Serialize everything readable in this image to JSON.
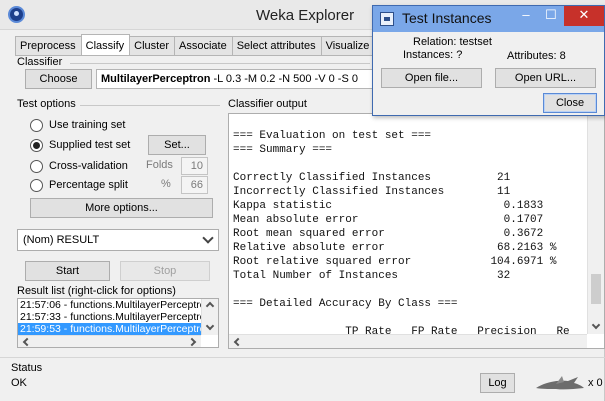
{
  "main_window": {
    "title": "Weka Explorer",
    "tabs": [
      "Preprocess",
      "Classify",
      "Cluster",
      "Associate",
      "Select attributes",
      "Visualize"
    ],
    "active_tab": "Classify"
  },
  "classifier": {
    "section_label": "Classifier",
    "choose_label": "Choose",
    "name": "MultilayerPerceptron",
    "options": " -L 0.3 -M 0.2 -N 500 -V 0 -S 0"
  },
  "test_options": {
    "label": "Test options",
    "use_training": "Use training set",
    "supplied": "Supplied test set",
    "set_button": "Set...",
    "cross_validation": "Cross-validation",
    "folds_label": "Folds",
    "folds_value": "10",
    "percentage_split": "Percentage split",
    "percent_label": "%",
    "percent_value": "66",
    "more_options": "More options..."
  },
  "class_select": {
    "value": "(Nom) RESULT"
  },
  "actions": {
    "start": "Start",
    "stop": "Stop"
  },
  "result_list": {
    "label": "Result list (right-click for options)",
    "items": [
      "21:57:06 - functions.MultilayerPerceptron",
      "21:57:33 - functions.MultilayerPerceptron",
      "21:59:53 - functions.MultilayerPerceptron"
    ]
  },
  "output": {
    "label": "Classifier output",
    "lines": [
      "=== Evaluation on test set ===",
      "=== Summary ===",
      "",
      "Correctly Classified Instances          21",
      "Incorrectly Classified Instances        11",
      "Kappa statistic                          0.1833",
      "Mean absolute error                      0.1707",
      "Root mean squared error                  0.3672",
      "Relative absolute error                 68.2163 %",
      "Root relative squared error            104.6971 %",
      "Total Number of Instances               32",
      "",
      "=== Detailed Accuracy By Class ===",
      "",
      "                 TP Rate   FP Rate   Precision   Re"
    ]
  },
  "status": {
    "label": "Status",
    "text": "OK",
    "log_button": "Log",
    "x_count": "x 0"
  },
  "popup": {
    "title": "Test Instances",
    "relation_label": "Relation: testset",
    "instances_label": "Instances: ?",
    "attributes_label": "Attributes: 8",
    "open_file": "Open file...",
    "open_url": "Open URL...",
    "close": "Close",
    "minimize_glyph": "–",
    "maximize_glyph": "☐",
    "close_glyph": "✕"
  }
}
